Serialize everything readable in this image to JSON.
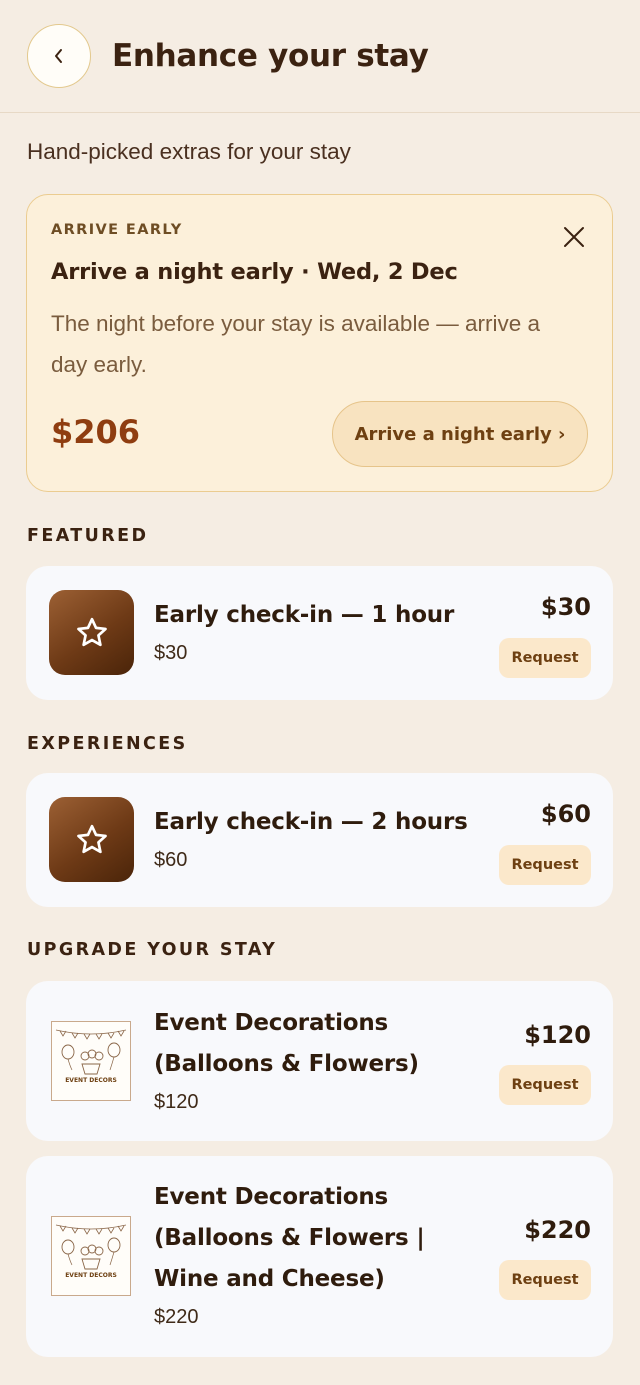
{
  "header": {
    "title": "Enhance your stay",
    "back_icon": "chevron-left-icon"
  },
  "subtitle": "Hand-picked extras for your stay",
  "promo": {
    "eyebrow": "ARRIVE EARLY",
    "title": "Arrive a night early · Wed, 2 Dec",
    "description": "The night before your stay is available — arrive a day early.",
    "price": "$206",
    "button_label": "Arrive a night early ›",
    "close_icon": "close-icon"
  },
  "sections": [
    {
      "label": "FEATURED",
      "items": [
        {
          "title": "Early check-in — 1 hour",
          "price_sub": "$30",
          "price": "$30",
          "button": "Request",
          "icon": "star-icon"
        }
      ]
    },
    {
      "label": "EXPERIENCES",
      "items": [
        {
          "title": "Early check-in — 2 hours",
          "price_sub": "$60",
          "price": "$60",
          "button": "Request",
          "icon": "star-icon"
        }
      ]
    },
    {
      "label": "UPGRADE YOUR STAY",
      "items": [
        {
          "title_lines": [
            "Event Decorations",
            "(Balloons & Flowers)"
          ],
          "price_sub": "$120",
          "price": "$120",
          "button": "Request",
          "thumb_text": "EVENT DECORS"
        },
        {
          "title_lines": [
            "Event Decorations",
            "(Balloons & Flowers |",
            "Wine and Cheese)"
          ],
          "price_sub": "$220",
          "price": "$220",
          "button": "Request",
          "thumb_text": "EVENT DECORS"
        }
      ]
    }
  ],
  "colors": {
    "background": "#f5ede3",
    "accent_price": "#8f3d10",
    "card": "#f8f9fc",
    "promo_bg": "#fcf0da"
  }
}
